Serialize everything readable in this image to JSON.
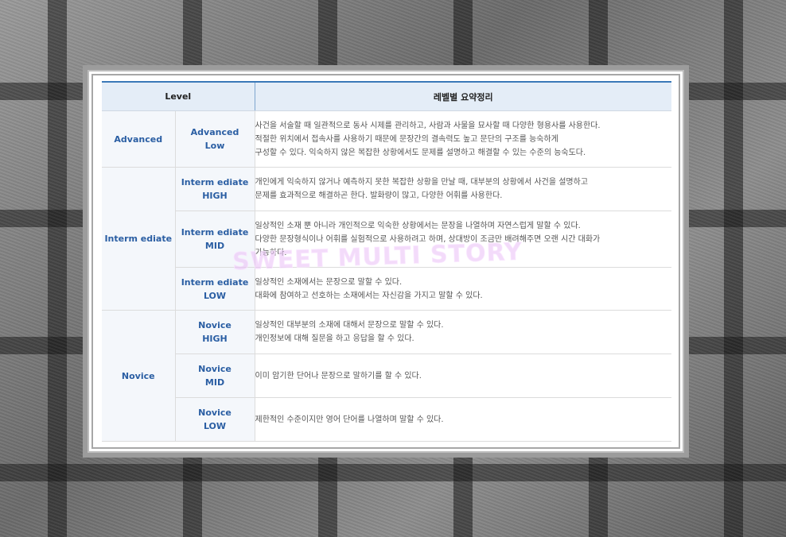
{
  "table": {
    "header_level": "Level",
    "header_summary": "레벨별 요약정리",
    "groups": {
      "advanced": "Advanced",
      "intermediate": "Interm ediate",
      "novice": "Novice"
    },
    "rows": [
      {
        "sub_line1": "Advanced",
        "sub_line2": "Low",
        "desc": [
          "사건을 서술할 때 일관적으로 동사 시제를 관리하고, 사람과 사물을 묘사할 때 다양한 형용사를 사용한다.",
          "적절한 위치에서 접속사를 사용하기 때문에 문장간의 결속력도 높고 문단의 구조를 능숙하게",
          "구성할 수 있다. 익숙하지 않은 복잡한 상황에서도 문제를 설명하고 해결할 수 있는 수준의 능숙도다."
        ]
      },
      {
        "sub_line1": "Interm ediate",
        "sub_line2": "HIGH",
        "desc": [
          "개인에게 익숙하지 않거나 예측하지 못한 복잡한 상황을 만날 때, 대부분의 상황에서 사건을 설명하고",
          "문제를 효과적으로 해결하곤 한다. 발화량이 많고, 다양한 어휘를 사용한다."
        ]
      },
      {
        "sub_line1": "Interm ediate",
        "sub_line2": "MID",
        "desc": [
          "일상적인 소재 뿐 아니라 개인적으로 익숙한 상황에서는 문장을 나열하며 자연스럽게 말할 수 있다.",
          "다양한 문장형식이나 어휘를 실험적으로 사용하려고 하며, 상대방이 조금만 배려해주면 오랜 시간 대화가",
          "가능하다."
        ]
      },
      {
        "sub_line1": "Interm ediate",
        "sub_line2": "LOW",
        "desc": [
          "일상적인 소재에서는 문장으로 말할 수 있다.",
          "대화에 참여하고 선호하는 소재에서는 자신감을 가지고 말할 수 있다."
        ]
      },
      {
        "sub_line1": "Novice",
        "sub_line2": "HIGH",
        "desc": [
          "일상적인 대부분의 소재에 대해서 문장으로 말할 수 있다.",
          "개인정보에 대해 질문을 하고 응답을 할 수 있다."
        ]
      },
      {
        "sub_line1": "Novice",
        "sub_line2": "MID",
        "desc": [
          "이미 암기한 단어나 문장으로 말하기를 할 수 있다."
        ]
      },
      {
        "sub_line1": "Novice",
        "sub_line2": "LOW",
        "desc": [
          "제한적인 수준이지만 영어 단어를 나열하며 말할 수 있다."
        ]
      }
    ]
  },
  "watermark": "SWEET MULTI STORY"
}
